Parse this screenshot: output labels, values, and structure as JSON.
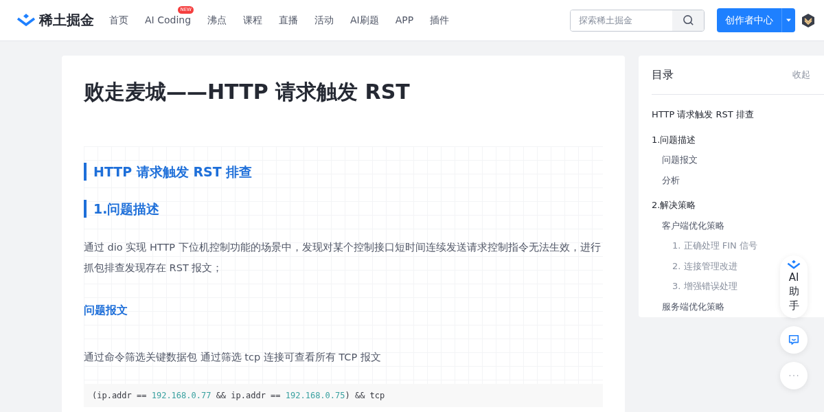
{
  "header": {
    "logo": "稀土掘金",
    "nav": [
      {
        "label": "首页"
      },
      {
        "label": "AI Coding",
        "badge": "NEW"
      },
      {
        "label": "沸点"
      },
      {
        "label": "课程"
      },
      {
        "label": "直播"
      },
      {
        "label": "活动"
      },
      {
        "label": "AI刷题"
      },
      {
        "label": "APP"
      },
      {
        "label": "插件"
      }
    ],
    "search": {
      "placeholder": "探索稀土掘金"
    },
    "creator_button": "创作者中心"
  },
  "article": {
    "title": "败走麦城——HTTP 请求触发 RST",
    "blocks": [
      {
        "kind": "h2",
        "text": "HTTP 请求触发 RST 排查"
      },
      {
        "kind": "h2",
        "text": "1.问题描述"
      },
      {
        "kind": "p",
        "text": "通过 dio 实现 HTTP 下位机控制功能的场景中，发现对某个控制接口短时间连续发送请求控制指令无法生效，进行抓包排查发现存在 RST 报文；"
      },
      {
        "kind": "h3",
        "text": "问题报文"
      },
      {
        "kind": "p",
        "text": "通过命令筛选关键数据包 通过筛选 tcp 连接可查看所有 TCP 报文"
      },
      {
        "kind": "code",
        "text": "(ip.addr == 192.168.0.77 && ip.addr == 192.168.0.75) && tcp"
      }
    ]
  },
  "toc": {
    "title": "目录",
    "collapse": "收起",
    "items": [
      {
        "label": "HTTP 请求触发 RST 排查"
      },
      {
        "label": "1.问题描述",
        "children": [
          {
            "label": "问题报文"
          },
          {
            "label": "分析"
          }
        ]
      },
      {
        "label": "2.解决策略",
        "children": [
          {
            "label": "客户端优化策略",
            "children": [
              {
                "label": "1. 正确处理 FIN 信号"
              },
              {
                "label": "2. 连接管理改进"
              },
              {
                "label": "3. 增强错误处理"
              }
            ]
          },
          {
            "label": "服务端优化策略"
          }
        ]
      }
    ]
  },
  "assistant": {
    "label": "AI助手"
  }
}
